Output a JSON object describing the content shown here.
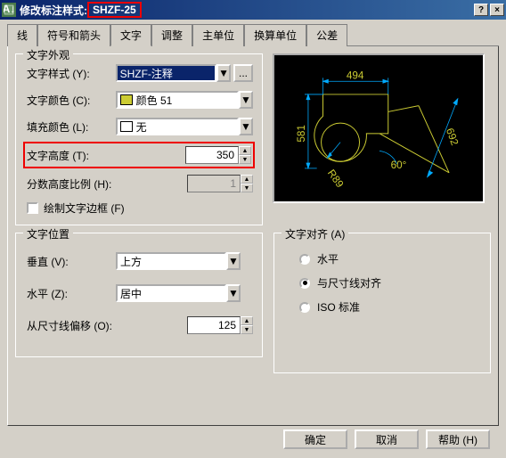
{
  "window": {
    "title_prefix": "修改标注样式:",
    "title_style": "SHZF-25",
    "help_icon": "?",
    "close_icon": "×"
  },
  "tabs": {
    "t0": "线",
    "t1": "符号和箭头",
    "t2": "文字",
    "t3": "调整",
    "t4": "主单位",
    "t5": "换算单位",
    "t6": "公差"
  },
  "appearance": {
    "legend": "文字外观",
    "style_label": "文字样式 (Y):",
    "style_value": "SHZF-注释",
    "ellipsis": "...",
    "color_label": "文字颜色 (C):",
    "color_value": "颜色 51",
    "fill_label": "填充颜色 (L):",
    "fill_value": "无",
    "height_label": "文字高度 (T):",
    "height_value": "350",
    "fraction_label": "分数高度比例 (H):",
    "fraction_value": "1",
    "frame_label": "绘制文字边框 (F)"
  },
  "position": {
    "legend": "文字位置",
    "vert_label": "垂直 (V):",
    "vert_value": "上方",
    "horiz_label": "水平 (Z):",
    "horiz_value": "居中",
    "offset_label": "从尺寸线偏移 (O):",
    "offset_value": "125"
  },
  "alignment": {
    "legend": "文字对齐 (A)",
    "opt1": "水平",
    "opt2": "与尺寸线对齐",
    "opt3": "ISO 标准"
  },
  "preview": {
    "dim1": "494",
    "dim2": "581",
    "dim3": "692",
    "angle": "60°",
    "radius": "R89"
  },
  "buttons": {
    "ok": "确定",
    "cancel": "取消",
    "help": "帮助 (H)"
  },
  "icons": {
    "dropdown": "▼",
    "spinup": "▲",
    "spindown": "▼"
  }
}
